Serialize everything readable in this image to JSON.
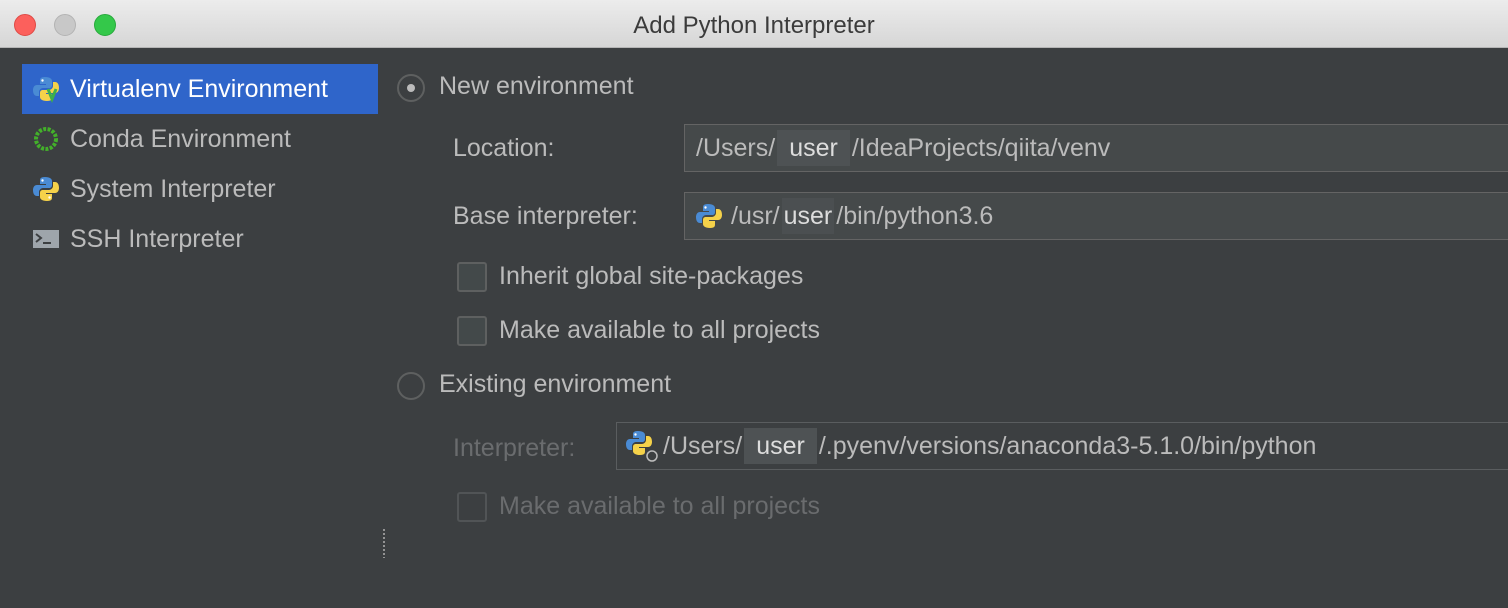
{
  "window": {
    "title": "Add Python Interpreter"
  },
  "sidebar": {
    "items": [
      {
        "label": "Virtualenv Environment",
        "icon": "virtualenv-python-icon",
        "selected": true
      },
      {
        "label": "Conda Environment",
        "icon": "conda-icon",
        "selected": false
      },
      {
        "label": "System Interpreter",
        "icon": "python-icon",
        "selected": false
      },
      {
        "label": "SSH Interpreter",
        "icon": "terminal-icon",
        "selected": false
      }
    ]
  },
  "new_env": {
    "radio_label": "New environment",
    "checked": true,
    "location_label": "Location:",
    "location_prefix": "/Users/",
    "location_user": "user",
    "location_suffix": "/IdeaProjects/qiita/venv",
    "base_label": "Base interpreter:",
    "base_prefix": "/usr/",
    "base_user": "user",
    "base_suffix": "/bin/python3.6",
    "inherit_label": "Inherit global site-packages",
    "make_available_label": "Make available to all projects"
  },
  "existing_env": {
    "radio_label": "Existing environment",
    "checked": false,
    "interpreter_label": "Interpreter:",
    "interpreter_prefix": "/Users/",
    "interpreter_user": "user",
    "interpreter_suffix": "/.pyenv/versions/anaconda3-5.1.0/bin/python",
    "make_available_label": "Make available to all projects"
  },
  "colors": {
    "selection": "#2f65ca",
    "background": "#3c3f41",
    "text": "#bbbbbb",
    "disabled_text": "#6a6c6e"
  }
}
